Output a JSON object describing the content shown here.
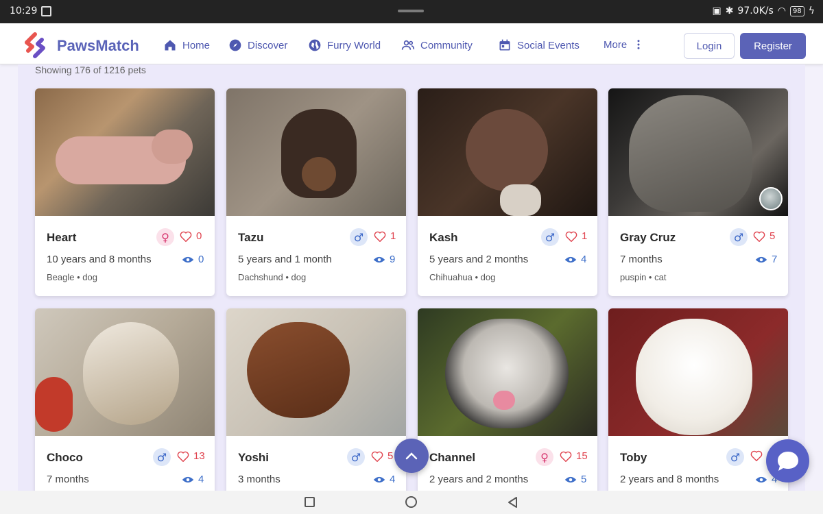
{
  "status_bar": {
    "time": "10:29",
    "net_speed": "97.0K/s",
    "battery": "98"
  },
  "brand": {
    "name": "PawsMatch"
  },
  "nav": {
    "items": [
      {
        "label": "Home",
        "icon": "home-icon"
      },
      {
        "label": "Discover",
        "icon": "compass-icon"
      },
      {
        "label": "Furry World",
        "icon": "globe-icon"
      },
      {
        "label": "Community",
        "icon": "people-icon"
      },
      {
        "label": "Social Events",
        "icon": "calendar-icon"
      },
      {
        "label": "More",
        "icon": "more-vert-icon"
      }
    ],
    "login": "Login",
    "register": "Register"
  },
  "listing": {
    "showing": "Showing 176 of 1216 pets"
  },
  "pets": [
    {
      "name": "Heart",
      "gender": "female",
      "gender_symbol": "♀",
      "likes": "0",
      "age": "10 years and 8 months",
      "views": "0",
      "breed": "Beagle • dog"
    },
    {
      "name": "Tazu",
      "gender": "male",
      "gender_symbol": "♂",
      "likes": "1",
      "age": "5 years and 1 month",
      "views": "9",
      "breed": "Dachshund • dog"
    },
    {
      "name": "Kash",
      "gender": "male",
      "gender_symbol": "♂",
      "likes": "1",
      "age": "5 years and 2 months",
      "views": "4",
      "breed": "Chihuahua • dog"
    },
    {
      "name": "Gray Cruz",
      "gender": "male",
      "gender_symbol": "♂",
      "likes": "5",
      "age": "7 months",
      "views": "7",
      "breed": "puspin • cat"
    },
    {
      "name": "Choco",
      "gender": "male",
      "gender_symbol": "♂",
      "likes": "13",
      "age": "7 months",
      "views": "4",
      "breed": ""
    },
    {
      "name": "Yoshi",
      "gender": "male",
      "gender_symbol": "♂",
      "likes": "5",
      "age": "3 months",
      "views": "4",
      "breed": ""
    },
    {
      "name": "Channel",
      "gender": "female",
      "gender_symbol": "♀",
      "likes": "15",
      "age": "2 years and 2 months",
      "views": "5",
      "breed": ""
    },
    {
      "name": "Toby",
      "gender": "male",
      "gender_symbol": "♂",
      "likes": "",
      "age": "2 years and 8 months",
      "views": "4",
      "breed": ""
    }
  ],
  "colors": {
    "accent": "#5b63b7",
    "like": "#e0444f",
    "view": "#3e6fc9"
  }
}
